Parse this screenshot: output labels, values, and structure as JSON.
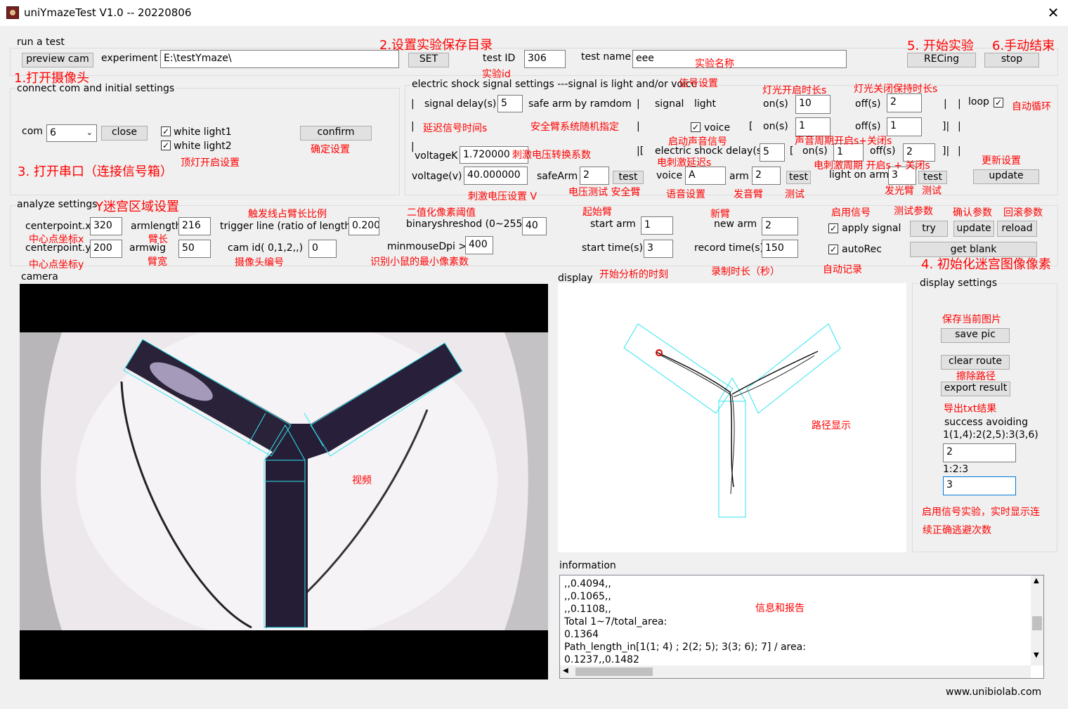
{
  "window": {
    "title": "uniYmazeTest V1.0  -- 20220806",
    "close": "✕"
  },
  "run": {
    "group": "run a test",
    "preview": "preview cam",
    "experiment_label": "experiment",
    "path": "E:\\testYmaze\\",
    "set": "SET",
    "testid_label": "test ID",
    "testid": "306",
    "testname_label": "test name",
    "testname": "eee",
    "recing": "RECing",
    "stop": "stop"
  },
  "conn": {
    "group": "connect com and initial settings",
    "com_label": "com",
    "com": "6",
    "close": "close",
    "light1": "white light1",
    "light2": "white light2",
    "confirm": "confirm"
  },
  "shock": {
    "group": "electric shock signal settings ---signal  is light and/or voice",
    "signal_delay_label": "signal delay(s)",
    "signal_delay": "5",
    "safe_arm": "safe arm by ramdom",
    "signal_label": "signal",
    "light_label": "light",
    "on_label": "on(s)",
    "on": "10",
    "off_label": "off(s)",
    "off": "2",
    "loop": "loop",
    "voice_label": "voice",
    "voice_on": "1",
    "voice_off": "1",
    "voltagek_label": "voltageK",
    "voltagek": "1.720000",
    "esd_label": "electric shock delay(s)",
    "esd": "5",
    "es_on": "1",
    "es_off": "2",
    "voltage_label": "voltage(v)",
    "voltage": "40.000000",
    "safearm_label": "safeArm",
    "safearm": "2",
    "test": "test",
    "voice2_label": "voice",
    "voice2": "A",
    "arm_label": "arm",
    "arm": "2",
    "lightonarm_label": "light on arm",
    "lightonarm": "3",
    "update": "update",
    "bar": "|",
    "lbr": "[",
    "rbr": "]|",
    "bar_lbr": "|["
  },
  "analyze": {
    "group": "analyze settings",
    "cpx_label": "centerpoint.x",
    "cpx": "320",
    "cpy_label": "centerpoint.y",
    "cpy": "200",
    "armlength_label": "armlength",
    "armlength": "216",
    "armwig_label": "armwig",
    "armwig": "50",
    "trigger_label": "trigger line  (ratio of length)",
    "trigger": "0.200",
    "camid_label": "cam id( 0,1,2,,)",
    "camid": "0",
    "binary_label": "binaryshreshod (0~255)",
    "binary": "40",
    "minmouse_label": "minmouseDpi >",
    "minmouse": "400",
    "startarm_label": "start arm",
    "startarm": "1",
    "newarm_label": "new arm",
    "newarm": "2",
    "starttime_label": "start time(s)",
    "starttime": "3",
    "recordtime_label": "record time(s)",
    "recordtime": "150",
    "apply_signal": "apply signal",
    "autorec": "autoRec",
    "try": "try",
    "update": "update",
    "reload": "reload",
    "getblank": "get blank"
  },
  "camera": {
    "label": "camera"
  },
  "display": {
    "label": "display"
  },
  "dsettings": {
    "group": "display settings",
    "savepic": "save pic",
    "clearroute": "clear route",
    "export": "export result",
    "success": "success avoiding",
    "ratio1": "1(1,4):2(2,5):3(3,6)",
    "v1": "2",
    "ratio2": "1:2:3",
    "v2": "3"
  },
  "info": {
    "label": "information",
    "lines": [
      ",,0.4094,,",
      ",,0.1065,,",
      ",,0.1108,,",
      "Total 1~7/total_area:",
      "0.1364",
      "Path_length_in[1(1; 4) ; 2(2; 5); 3(3; 6); 7] / area:",
      "0.1237,,0.1482"
    ]
  },
  "footer": {
    "url": "www.unibiolab.com"
  },
  "ann": {
    "a1": "2.设置实验保存目录",
    "a2": "5. 开始实验",
    "a3": "6.手动结束",
    "a4": "1.打开摄像头",
    "a5": "实验id",
    "a6": "实验名称",
    "a7": "信号设置",
    "a8": "灯光开启时长s",
    "a9": "灯光关闭保持时长s",
    "a10": "自动循环",
    "a11": "延迟信号时间s",
    "a12": "安全臂系统随机指定",
    "a13": "启动声音信号",
    "a14": "声音周期开启s+关闭s",
    "a15": "电刺激延迟s",
    "a16": "电刺激周期 开启s + 关闭s",
    "a17": "刺激电压转换系数",
    "a18": "更新设置",
    "a19": "确定设置",
    "a20": "顶灯开启设置",
    "a21": "3. 打开串口（连接信号箱）",
    "a22": "刺激电压设置 V",
    "a23": "电压测试 安全臂",
    "a24": "语音设置",
    "a25": "发音臂",
    "a26": "测试",
    "a27": "发光臂",
    "a28": "测试",
    "a29": "Y迷宫区域设置",
    "a30": "触发线占臂长比例",
    "a31": "二值化像素阈值",
    "a32": "起始臂",
    "a33": "新臂",
    "a34": "启用信号",
    "a35": "测试参数",
    "a36": "确认参数",
    "a37": "回滚参数",
    "a38": "中心点坐标x",
    "a39": "臂长",
    "a40": "中心点坐标y",
    "a41": "臂宽",
    "a42": "摄像头编号",
    "a43": "识别小鼠的最小像素数",
    "a44": "开始分析的时刻",
    "a45": "录制时长（秒）",
    "a46": "自动记录",
    "a47": "4. 初始化迷宫图像像素",
    "a48": "视频",
    "a49": "路径显示",
    "a50": "保存当前图片",
    "a51": "擦除路径",
    "a52": "导出txt结果",
    "a53": "启用信号实验，实时显示连",
    "a54": "续正确逃避次数",
    "a55": "信息和报告"
  }
}
